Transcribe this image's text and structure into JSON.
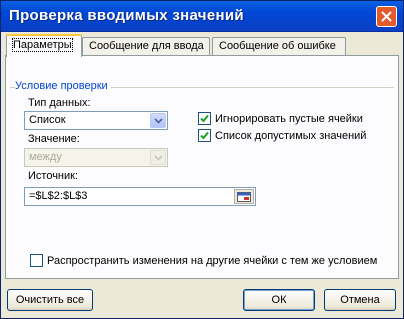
{
  "dialog": {
    "title": "Проверка вводимых значений",
    "close_icon": "close-icon"
  },
  "tabs": [
    {
      "label": "Параметры",
      "active": true
    },
    {
      "label": "Сообщение для ввода",
      "active": false
    },
    {
      "label": "Сообщение об ошибке",
      "active": false
    }
  ],
  "settings": {
    "group_label": "Условие проверки",
    "data_type_label": "Тип данных:",
    "data_type_value": "Список",
    "value_label": "Значение:",
    "value_value": "между",
    "ignore_blank_label": "Игнорировать пустые ячейки",
    "ignore_blank_checked": true,
    "dropdown_label": "Список допустимых значений",
    "dropdown_checked": true,
    "source_label": "Источник:",
    "source_value": "=$L$2:$L$3",
    "apply_all_label": "Распространить изменения на другие ячейки с тем же условием",
    "apply_all_checked": false
  },
  "buttons": {
    "clear_all": "Очистить все",
    "ok": "ОК",
    "cancel": "Отмена"
  },
  "colors": {
    "titlebar": "#0046d5",
    "dialog_bg": "#ece9d8",
    "check_mark": "#21a121",
    "group_label": "#0046d5"
  }
}
